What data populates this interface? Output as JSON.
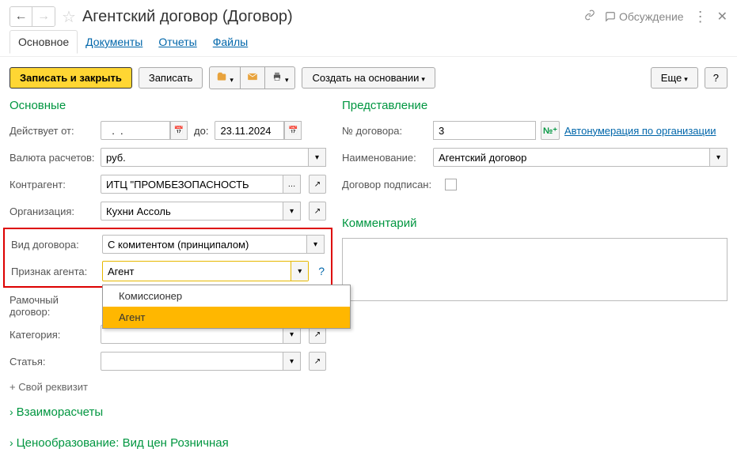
{
  "header": {
    "title": "Агентский договор (Договор)",
    "discuss_label": "Обсуждение"
  },
  "tabs": {
    "main": "Основное",
    "documents": "Документы",
    "reports": "Отчеты",
    "files": "Файлы"
  },
  "toolbar": {
    "save_close": "Записать и закрыть",
    "save": "Записать",
    "create_based": "Создать на основании",
    "more": "Еще"
  },
  "sections": {
    "main": "Основные",
    "presentation": "Представление",
    "comment": "Комментарий",
    "settlements": "Взаиморасчеты",
    "pricing": "Ценообразование: Вид цен Розничная"
  },
  "fields": {
    "valid_from_label": "Действует от:",
    "valid_to_label": "до:",
    "valid_from_value": "  .  .    ",
    "valid_to_value": "23.11.2024",
    "currency_label": "Валюта расчетов:",
    "currency_value": "руб.",
    "counterparty_label": "Контрагент:",
    "counterparty_value": "ИТЦ \"ПРОМБЕЗОПАСНОСТЬ",
    "organization_label": "Организация:",
    "organization_value": "Кухни Ассоль",
    "contract_type_label": "Вид договора:",
    "contract_type_value": "С комитентом (принципалом)",
    "agent_sign_label": "Признак агента:",
    "agent_sign_value": "Агент",
    "frame_contract_label": "Рамочный договор:",
    "category_label": "Категория:",
    "article_label": "Статья:",
    "own_req": "+ Свой реквизит",
    "contract_no_label": "№ договора:",
    "contract_no_value": "3",
    "autonum_link": "Автонумерация по организации",
    "name_label": "Наименование:",
    "name_value": "Агентский договор",
    "signed_label": "Договор подписан:"
  },
  "dropdown": {
    "option1": "Комиссионер",
    "option2": "Агент"
  }
}
